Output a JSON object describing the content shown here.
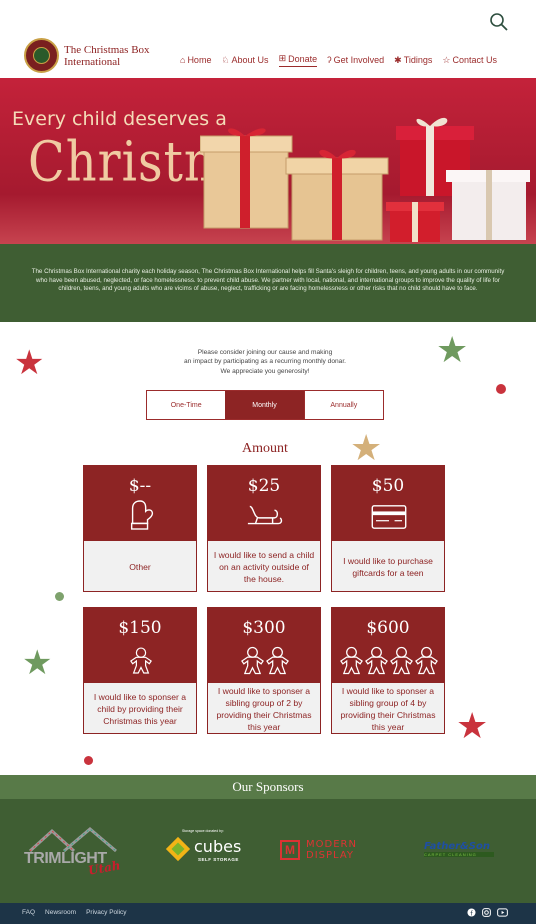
{
  "header": {
    "brand_line1": "The Christmas Box",
    "brand_line2": "International",
    "nav": [
      {
        "icon": "home-icon",
        "glyph": "⌂",
        "label": "Home"
      },
      {
        "icon": "angel-icon",
        "glyph": "♘",
        "label": "About Us"
      },
      {
        "icon": "gift-icon",
        "glyph": "⊞",
        "label": "Donate"
      },
      {
        "icon": "candy-cane-icon",
        "glyph": "ʔ",
        "label": "Get Involved"
      },
      {
        "icon": "snowflake-icon",
        "glyph": "✱",
        "label": "Tidings"
      },
      {
        "icon": "tree-icon",
        "glyph": "☆",
        "label": "Contact Us"
      }
    ]
  },
  "hero": {
    "tagline": "Every child deserves a",
    "headline": "Christmas"
  },
  "mission": {
    "text": "The Christmas Box International charity each holiday season, The Christmas Box International helps fill Santa's sleigh for children, teens, and young adults in our community who have been abused, neglected, or face homelessness. to prevent child abuse. We partner with local, national, and international groups to improve the quality of life for children, teens, and young adults who are vicims of abuse, neglect, trafficking or are facing homelessness or other risks that no child should have to face."
  },
  "appeal": {
    "line1": "Please consider joining our cause and making",
    "line2": "an impact by participating as a recurring monthly donar.",
    "line3": "We appreciate you generosity!"
  },
  "frequency": {
    "options": [
      "One-Time",
      "Monthly",
      "Annually"
    ],
    "selected": "Monthly"
  },
  "amount_title": "Amount",
  "cards": [
    {
      "price": "$--",
      "icon": "mitten-icon",
      "glyph": "🧤",
      "desc": "Other"
    },
    {
      "price": "$25",
      "icon": "sleigh-icon",
      "glyph": "🛷",
      "desc": "I would like to send a child on an activity outside of the house."
    },
    {
      "price": "$50",
      "icon": "giftcard-icon",
      "glyph": "▤",
      "desc": "I would like to purchase giftcards for a teen"
    },
    {
      "price": "$150",
      "icon": "gingerbread-icon",
      "glyph": "☃",
      "desc": "I would like to sponser a child by providing their Christmas this year"
    },
    {
      "price": "$300",
      "icon": "gingerbread-pair-icon",
      "glyph": "☃☃",
      "desc": "I would like to sponser a sibling group of 2 by providing their Christmas this year"
    },
    {
      "price": "$600",
      "icon": "gingerbread-group-icon",
      "glyph": "☃☃☃☃",
      "desc": "I would like to sponser a sibling group of 4 by providing their Christmas this year"
    }
  ],
  "sponsors": {
    "title": "Our Sponsors",
    "items": [
      {
        "name": "TRIMLIGHT",
        "sub": "Utah",
        "icon": "trimlight-logo"
      },
      {
        "name": "cubes",
        "sub": "SELF STORAGE",
        "note": "Storage space donated by:",
        "icon": "cubes-logo"
      },
      {
        "name": "MODERN DISPLAY",
        "icon": "modern-display-logo"
      },
      {
        "name": "Father&Son",
        "sub": "CARPET CLEANING",
        "icon": "father-son-logo"
      }
    ]
  },
  "footer": {
    "links": [
      "FAQ",
      "Newsroom",
      "Privacy Policy"
    ],
    "social": [
      "facebook-icon",
      "instagram-icon",
      "youtube-icon"
    ]
  },
  "colors": {
    "brand_red": "#8d2424",
    "green": "#3f5e33",
    "sponsor_band": "#587a48",
    "footer": "#1d3447"
  }
}
